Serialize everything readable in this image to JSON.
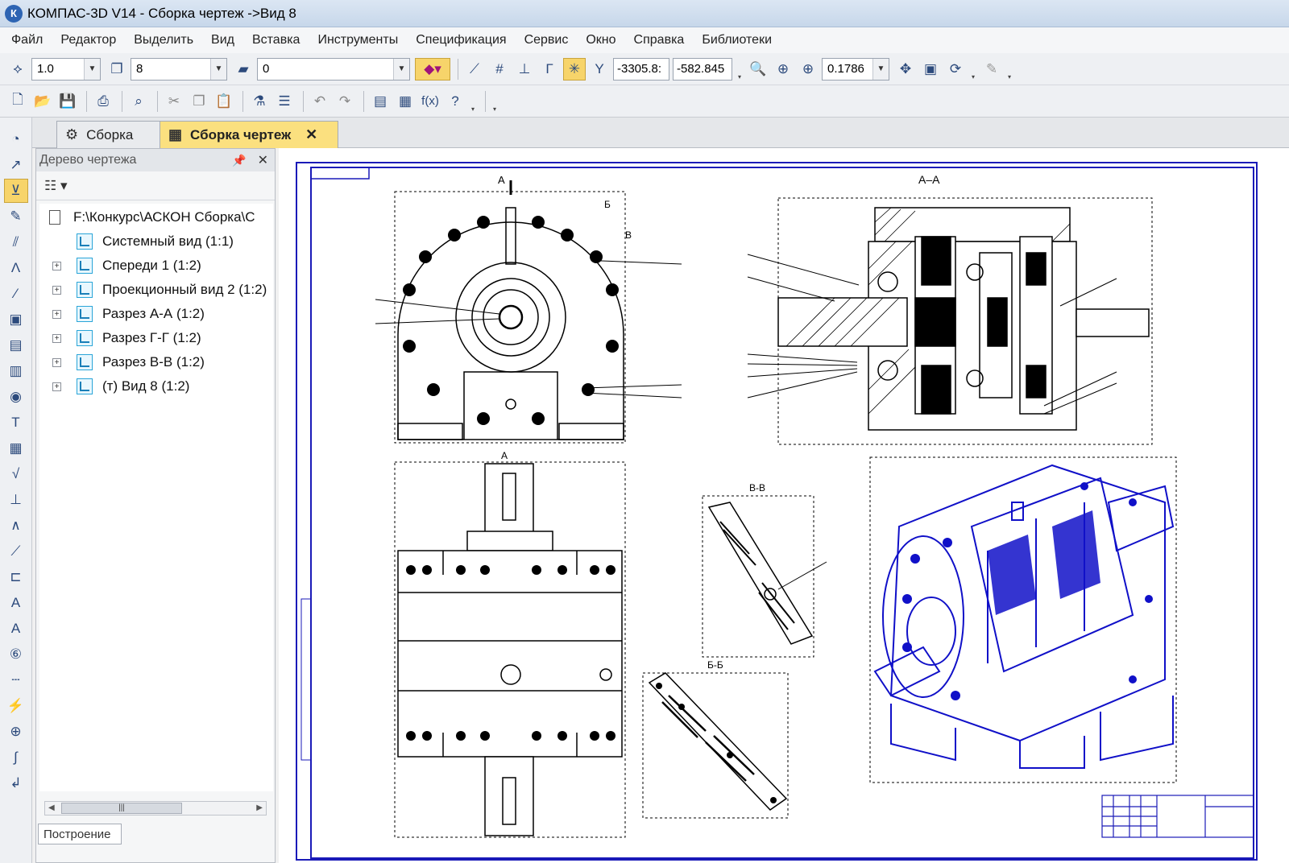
{
  "window": {
    "title": "КОМПАС-3D V14 - Сборка чертеж ->Вид 8",
    "logo": "К"
  },
  "menu": [
    "Файл",
    "Редактор",
    "Выделить",
    "Вид",
    "Вставка",
    "Инструменты",
    "Спецификация",
    "Сервис",
    "Окно",
    "Справка",
    "Библиотеки"
  ],
  "toolbar1": {
    "scale_value": "1.0",
    "view_value": "8",
    "layer_value": "0",
    "coord_x": "-3305.8:",
    "coord_y": "-582.845",
    "zoom_value": "0.1786"
  },
  "tabs": [
    {
      "label": "Сборка",
      "active": false
    },
    {
      "label": "Сборка чертеж",
      "active": true
    }
  ],
  "tree_panel": {
    "title": "Дерево чертежа",
    "root": "F:\\Конкурс\\АСКОН Сборка\\С",
    "items": [
      {
        "label": "Системный вид (1:1)",
        "expandable": false
      },
      {
        "label": "Спереди 1 (1:2)",
        "expandable": true
      },
      {
        "label": "Проекционный вид 2 (1:2)",
        "expandable": true
      },
      {
        "label": "Разрез А-А (1:2)",
        "expandable": true
      },
      {
        "label": "Разрез Г-Г (1:2)",
        "expandable": true
      },
      {
        "label": "Разрез В-В (1:2)",
        "expandable": true
      },
      {
        "label": "(т) Вид 8 (1:2)",
        "expandable": true
      }
    ],
    "footer_tab": "Построение"
  },
  "drawing": {
    "labels": {
      "section_aa": "А–А",
      "section_vv": "В-В",
      "section_bb": "Б-Б",
      "mark_a": "А",
      "mark_b": "Б",
      "mark_v": "В"
    },
    "accent_color": "#1010c8",
    "frame_color": "#1a1ab8"
  }
}
